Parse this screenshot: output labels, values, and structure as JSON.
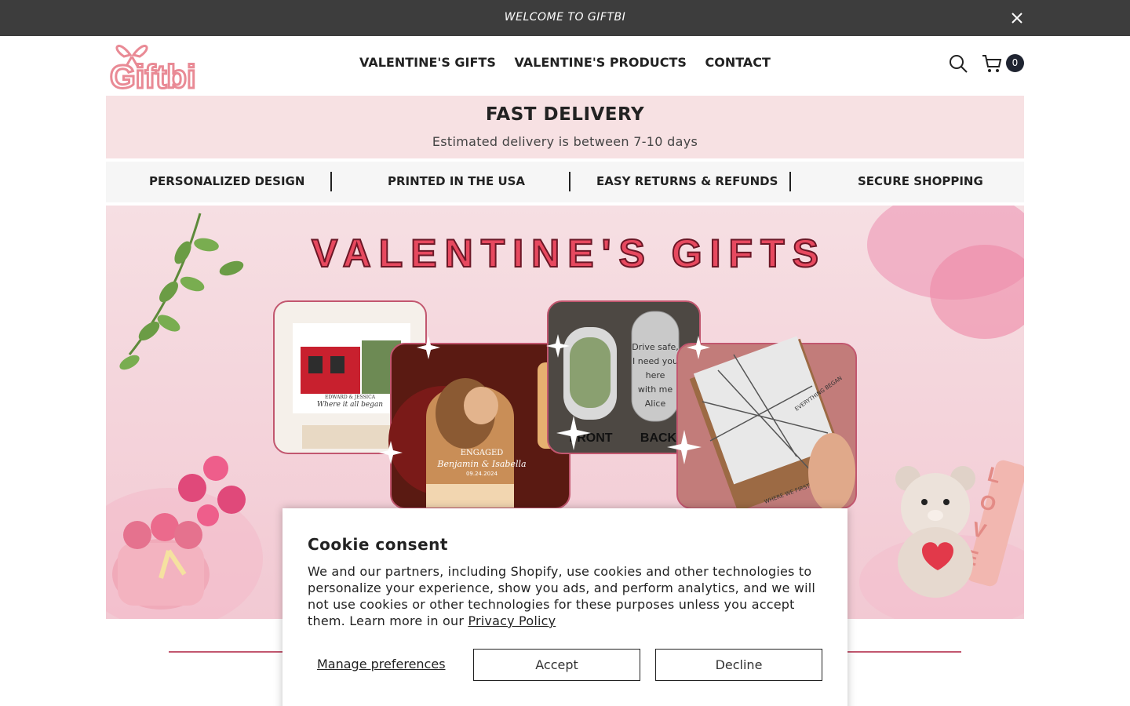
{
  "announcement": {
    "text": "WELCOME TO GIFTBI",
    "close_icon": "close-icon"
  },
  "header": {
    "logo_text": "Giftbi",
    "nav": [
      "VALENTINE'S GIFTS",
      "VALENTINE'S PRODUCTS",
      "CONTACT"
    ],
    "search_icon": "search-icon",
    "cart_icon": "cart-icon",
    "cart_count": "0"
  },
  "delivery": {
    "title": "FAST DELIVERY",
    "subtitle": "Estimated delivery is between 7-10 days"
  },
  "features": [
    "PERSONALIZED DESIGN",
    "PRINTED IN THE USA",
    "EASY RETURNS & REFUNDS",
    "SECURE SHOPPING"
  ],
  "hero": {
    "title": "VALENTINE'S GIFTS",
    "canvas_caption": "Where it all began",
    "canvas_names": "EDWARD & JESSICA",
    "plaque_label": "ENGAGED",
    "plaque_names": "Benjamin & Isabella",
    "plaque_date": "09.24.2024",
    "tag_text": [
      "Drive safe,",
      "I need you",
      "here",
      "with me",
      "Alice"
    ],
    "tag_front": "FRONT",
    "tag_back": "BACK",
    "map_text_1": "EVERYTHING BEGAN",
    "map_text_2": "WHERE WE FIRST MET",
    "bear_text": "LOVE"
  },
  "cookie": {
    "title": "Cookie consent",
    "body": "We and our partners, including Shopify, use cookies and other technologies to personalize your experience, show you ads, and perform analytics, and we will not use cookies or other technologies for these purposes unless you accept them. Learn more in our",
    "privacy_link": "Privacy Policy",
    "manage": "Manage preferences",
    "accept": "Accept",
    "decline": "Decline"
  },
  "colors": {
    "announcement_bg": "#3d3d3d",
    "delivery_bg": "#f7e1e3",
    "features_bg": "#f6f6f6",
    "brand_pink": "#e98a95",
    "divider": "#c2576f"
  }
}
